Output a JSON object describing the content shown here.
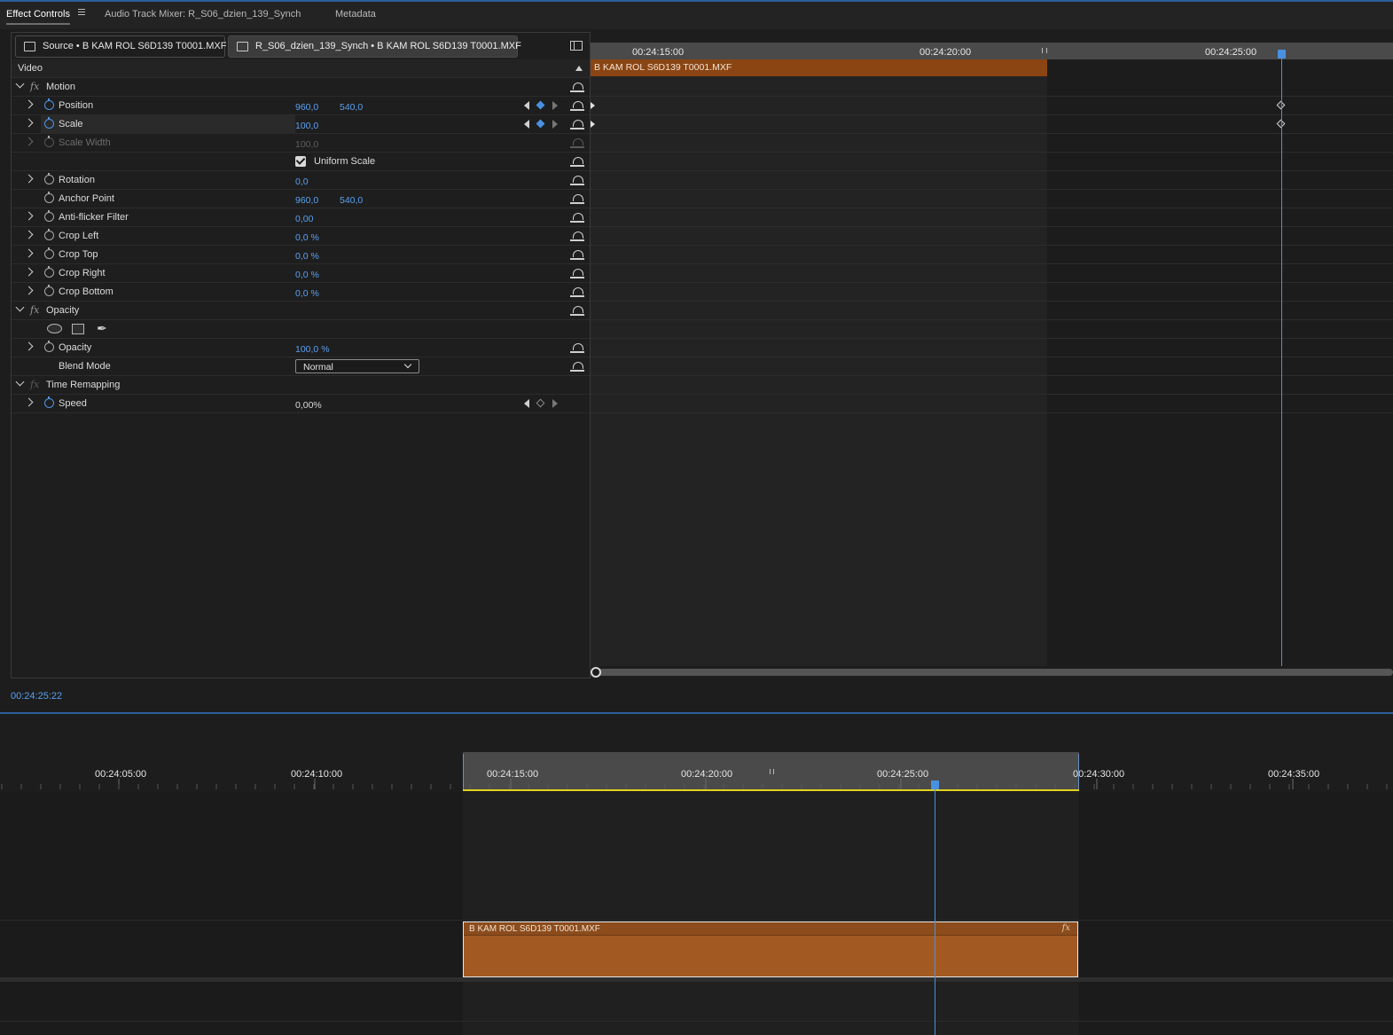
{
  "tabs": [
    {
      "label": "Effect Controls",
      "active": true
    },
    {
      "label": "Audio Track Mixer: R_S06_dzien_139_Synch",
      "active": false
    },
    {
      "label": "Metadata",
      "active": false
    }
  ],
  "clip_tabs": {
    "source": "Source • B KAM ROL S6D139 T0001.MXF",
    "sequence": "R_S06_dzien_139_Synch • B KAM ROL S6D139 T0001.MXF"
  },
  "section_header": "Video",
  "effects": {
    "motion": {
      "name": "Motion",
      "position": {
        "label": "Position",
        "x": "960,0",
        "y": "540,0"
      },
      "scale": {
        "label": "Scale",
        "value": "100,0"
      },
      "scale_width": {
        "label": "Scale Width",
        "value": "100,0"
      },
      "uniform_scale": {
        "label": "Uniform Scale",
        "checked": true
      },
      "rotation": {
        "label": "Rotation",
        "value": "0,0"
      },
      "anchor_point": {
        "label": "Anchor Point",
        "x": "960,0",
        "y": "540,0"
      },
      "anti_flicker": {
        "label": "Anti-flicker Filter",
        "value": "0,00"
      },
      "crop_left": {
        "label": "Crop Left",
        "value": "0,0 %"
      },
      "crop_top": {
        "label": "Crop Top",
        "value": "0,0 %"
      },
      "crop_right": {
        "label": "Crop Right",
        "value": "0,0 %"
      },
      "crop_bottom": {
        "label": "Crop Bottom",
        "value": "0,0 %"
      }
    },
    "opacity": {
      "name": "Opacity",
      "opacity": {
        "label": "Opacity",
        "value": "100,0 %"
      },
      "blend_mode": {
        "label": "Blend Mode",
        "value": "Normal"
      }
    },
    "time_remapping": {
      "name": "Time Remapping",
      "speed": {
        "label": "Speed",
        "value": "0,00%"
      }
    }
  },
  "ec_timeline": {
    "ruler": [
      "00:24:15:00",
      "00:24:20:00",
      "00:24:25:00"
    ],
    "clip_name": "B KAM ROL S6D139 T0001.MXF"
  },
  "current_timecode": "00:24:25:22",
  "sequence_timeline": {
    "ruler": [
      "00:24:05:00",
      "00:24:10:00",
      "00:24:15:00",
      "00:24:20:00",
      "00:24:25:00",
      "00:24:30:00",
      "00:24:35:00"
    ],
    "clip_name": "B KAM ROL S6D139 T0001.MXF",
    "clip_fx_badge": "fx"
  },
  "colors": {
    "accent": "#4a90e2",
    "clip_orange": "#a35a22",
    "in_out_bar": "#e2d31f"
  }
}
